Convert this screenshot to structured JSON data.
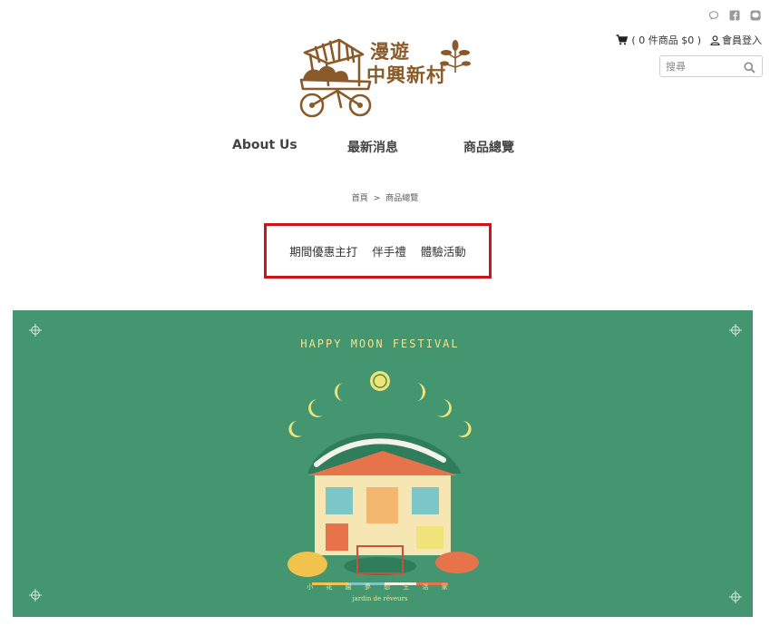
{
  "header": {
    "social_icons": [
      "chat-icon",
      "facebook-icon",
      "line-icon"
    ],
    "cart": {
      "icon": "cart-icon",
      "label": "( 0 件商品 $0 )"
    },
    "login": {
      "icon": "user-icon",
      "label": "會員登入"
    },
    "search": {
      "placeholder": "搜尋",
      "icon": "search-icon"
    }
  },
  "logo": {
    "line1": "漫遊",
    "line2": "中興新村"
  },
  "nav": {
    "items": [
      {
        "label": "About Us"
      },
      {
        "label": "最新消息"
      },
      {
        "label": "商品總覽"
      }
    ]
  },
  "breadcrumb": {
    "home": "首頁",
    "separator": ">",
    "current": "商品總覽"
  },
  "categories": {
    "items": [
      {
        "label": "期間優惠主打"
      },
      {
        "label": "伴手禮"
      },
      {
        "label": "體驗活動"
      }
    ],
    "highlight_color": "#d0121b"
  },
  "banner": {
    "background": "#43966f",
    "title": "HAPPY MOON FESTIVAL",
    "subtitle": "小 花 園 夢 想 生 活 家",
    "subtitle2": "jardin de rêveurs"
  }
}
